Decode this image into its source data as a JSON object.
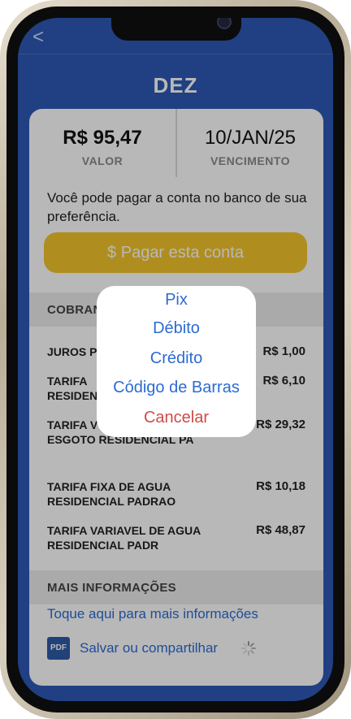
{
  "nav": {
    "back_icon": "chevron-left-icon",
    "back_glyph": "<"
  },
  "header": {
    "title": "DEZ"
  },
  "summary": {
    "value": "R$ 95,47",
    "value_label": "VALOR",
    "due_date": "10/JAN/25",
    "due_label": "VENCIMENTO"
  },
  "info": {
    "text": "Você pode pagar a conta no banco de sua preferência."
  },
  "pay_button": {
    "label": "$ Pagar esta conta",
    "color": "#f3c52b"
  },
  "charges": {
    "section_label": "COBRAN",
    "items": [
      {
        "label": "JUROS P",
        "value": "R$ 1,00"
      },
      {
        "label": "TARIFA\nRESIDEN",
        "value": "R$ 6,10"
      },
      {
        "label": "TARIFA V\nESGOTO RESIDENCIAL PA",
        "value": "R$ 29,32"
      },
      {
        "label": "TARIFA FIXA DE AGUA RESIDENCIAL PADRAO",
        "value": "R$ 10,18"
      },
      {
        "label": "TARIFA VARIAVEL DE AGUA RESIDENCIAL PADR",
        "value": "R$ 48,87"
      }
    ]
  },
  "more_info": {
    "section_label": "MAIS INFORMAÇÕES",
    "link_text": "Toque aqui para mais informações",
    "pdf_badge": "PDF",
    "pdf_label": "Salvar ou compartilhar"
  },
  "payment_sheet": {
    "options": [
      "Pix",
      "Débito",
      "Crédito",
      "Código de Barras"
    ],
    "cancel": "Cancelar"
  },
  "colors": {
    "background": "#2d59b6",
    "link": "#2d6bd1",
    "cancel": "#d04a4a"
  }
}
